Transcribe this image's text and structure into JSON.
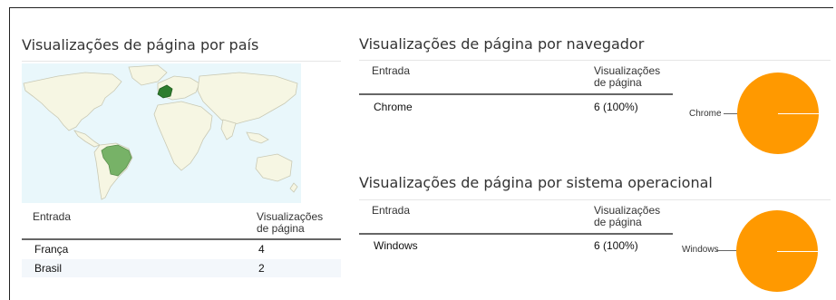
{
  "country": {
    "title": "Visualizações de página por país",
    "table": {
      "headers": {
        "entry": "Entrada",
        "views_line1": "Visualizações",
        "views_line2": "de página"
      },
      "rows": [
        {
          "entry": "França",
          "views": "4"
        },
        {
          "entry": "Brasil",
          "views": "2"
        }
      ]
    },
    "map_colors": {
      "ocean": "#e9f7fb",
      "land": "#f6f6e3",
      "france": "#2e7d2e",
      "brasil": "#77b267"
    }
  },
  "browser": {
    "title": "Visualizações de página por navegador",
    "table": {
      "headers": {
        "entry": "Entrada",
        "views_line1": "Visualizações",
        "views_line2": "de página"
      },
      "rows": [
        {
          "entry": "Chrome",
          "views": "6 (100%)"
        }
      ]
    },
    "chart_data": {
      "type": "pie",
      "labels": [
        "Chrome"
      ],
      "values": [
        6
      ],
      "colors": [
        "#ff9900"
      ]
    }
  },
  "os": {
    "title": "Visualizações de página por sistema operacional",
    "table": {
      "headers": {
        "entry": "Entrada",
        "views_line1": "Visualizações",
        "views_line2": "de página"
      },
      "rows": [
        {
          "entry": "Windows",
          "views": "6 (100%)"
        }
      ]
    },
    "chart_data": {
      "type": "pie",
      "labels": [
        "Windows"
      ],
      "values": [
        6
      ],
      "colors": [
        "#ff9900"
      ]
    }
  }
}
